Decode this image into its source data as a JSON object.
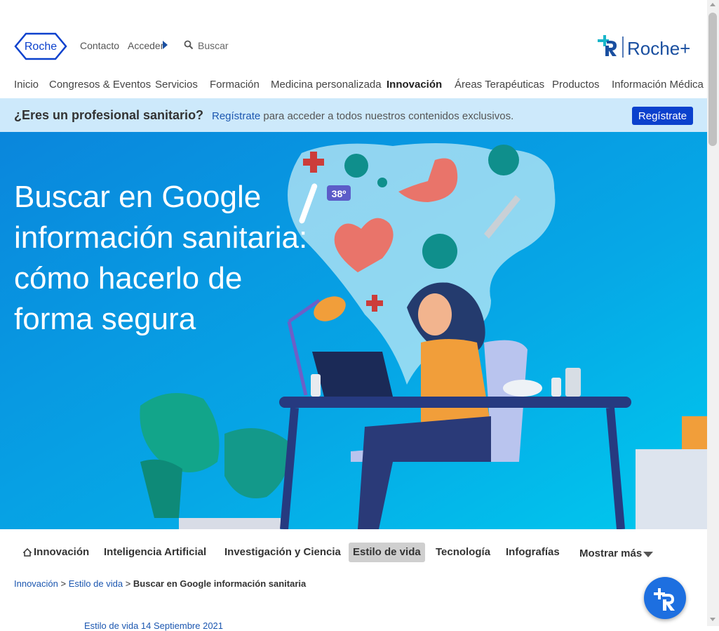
{
  "header": {
    "logo_text": "Roche",
    "contact_label": "Contacto",
    "login_label": "Acceder",
    "search_placeholder": "Buscar",
    "roche_plus_label": "Roche+"
  },
  "nav": {
    "items": [
      {
        "label": "Inicio"
      },
      {
        "label": "Congresos & Eventos"
      },
      {
        "label": "Servicios"
      },
      {
        "label": "Formación"
      },
      {
        "label": "Medicina personalizada"
      },
      {
        "label": "Innovación",
        "active": true
      },
      {
        "label": "Áreas Terapéuticas"
      },
      {
        "label": "Productos"
      },
      {
        "label": "Información Médica"
      }
    ]
  },
  "banner": {
    "question": "¿Eres un profesional sanitario?",
    "link_text": "Regístrate",
    "text": " para acceder a todos nuestros contenidos exclusivos.",
    "button_label": "Regístrate"
  },
  "hero": {
    "title": "Buscar en Google información sanitaria: cómo hacerlo de forma segura",
    "thermometer_label": "38º"
  },
  "categories": {
    "items": [
      {
        "label": "Innovación",
        "icon": "home-icon"
      },
      {
        "label": "Inteligencia Artificial"
      },
      {
        "label": "Investigación y Ciencia"
      },
      {
        "label": "Estilo de vida",
        "selected": true
      },
      {
        "label": "Tecnología"
      },
      {
        "label": "Infografías"
      }
    ],
    "more_label": "Mostrar más"
  },
  "breadcrumb": {
    "items": [
      "Innovación",
      "Estilo de vida"
    ],
    "separator": ">",
    "current": "Buscar en Google información sanitaria"
  },
  "meta": {
    "text": "Estilo de vida 14 Septiembre 2021"
  },
  "colors": {
    "brand_blue": "#0b41cd",
    "banner_bg": "#cde9fb",
    "link_blue": "#1c57b0",
    "hero_top": "#0094e0",
    "hero_bottom": "#0b6fd6"
  }
}
